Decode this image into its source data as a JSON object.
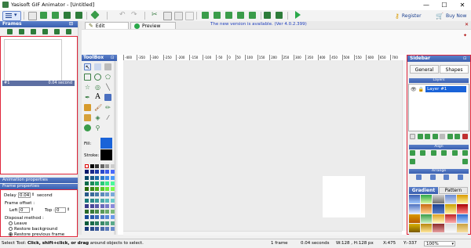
{
  "window": {
    "title": "Yasisoft GIF Animator - [Untitled]",
    "minimize": "—",
    "maximize": "☐",
    "close": "✕"
  },
  "toolbar": {
    "register_label": "Register",
    "buynow_label": "Buy Now"
  },
  "frames_panel": {
    "title": "Frames",
    "selected_frame_number": "#1",
    "selected_frame_delay": "0.04 second"
  },
  "animation_properties": {
    "title": "Animation properties"
  },
  "frame_properties": {
    "title": "Frame properties",
    "delay_label": "Delay :",
    "delay_value": "0.04",
    "delay_unit": "second",
    "offset_label": "Frame offset :",
    "left_label": "Left :",
    "left_value": "0",
    "top_label": "Top :",
    "top_value": "0",
    "disposal_label": "Disposal method :",
    "disposal_options": [
      "Leave",
      "Restore background",
      "Restore previous frame"
    ],
    "disposal_selected": "Restore previous frame"
  },
  "doc_tabs": {
    "edit_label": "Edit",
    "preview_label": "Preview",
    "update_notice": "The new version is available. (Ver 4.0.2.399)"
  },
  "toolbox": {
    "title": "ToolBox",
    "fill_label": "Fill:",
    "stroke_label": "Stroke:",
    "fill_color": "#1a63d8",
    "stroke_color": "#000000"
  },
  "ruler": {
    "ticks": [
      "-400",
      "-350",
      "-300",
      "-250",
      "-200",
      "-150",
      "-100",
      "-50",
      "0",
      "50",
      "100",
      "150",
      "200",
      "250",
      "300",
      "350",
      "400",
      "450",
      "500",
      "550",
      "600",
      "650",
      "700"
    ]
  },
  "sidebar": {
    "title": "Sidebar",
    "tabs": [
      "General",
      "Shapes"
    ],
    "layers_label": "Layers",
    "layer_name": "Layer #1",
    "align_label": "Align",
    "arrange_label": "Arrange",
    "bottom_tabs": [
      "Gradient",
      "Pattern"
    ],
    "zoom": "100%"
  },
  "status": {
    "hint_prefix": "Select Tool: ",
    "hint_bold": "Click, shift+click, or drag",
    "hint_suffix": " around objects to select.",
    "frame_count": "1 frame",
    "delay": "0.04 seconds",
    "size": "W:128 , H:128 px",
    "x": "X:475",
    "y": "Y:-337"
  },
  "colors": {
    "accent_blue": "#3a5fb0",
    "panel_border_red": "#e0253a",
    "canvas_bg": "#ececec"
  }
}
